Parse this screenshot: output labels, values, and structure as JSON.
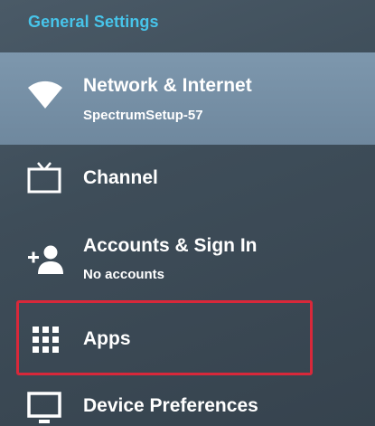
{
  "header": {
    "title": "General Settings"
  },
  "colors": {
    "header_text": "#47c4ea",
    "selected_bg": "#7d97ad",
    "highlight_border": "#d8283a"
  },
  "menu": {
    "items": [
      {
        "label": "Network & Internet",
        "sublabel": "SpectrumSetup-57",
        "icon": "wifi-icon",
        "selected": true
      },
      {
        "label": "Channel",
        "icon": "tv-icon"
      },
      {
        "label": "Accounts & Sign In",
        "sublabel": "No accounts",
        "icon": "add-person-icon"
      },
      {
        "label": "Apps",
        "icon": "apps-grid-icon",
        "highlighted": true
      },
      {
        "label": "Device Preferences",
        "icon": "monitor-icon"
      }
    ]
  }
}
